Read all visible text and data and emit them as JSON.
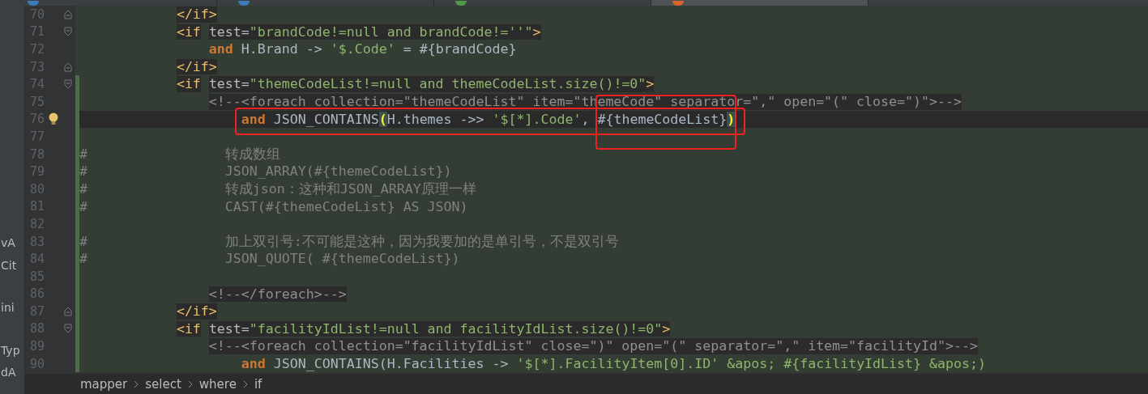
{
  "tabs": [
    {
      "selected": false,
      "color": "#3d7bbf"
    },
    {
      "selected": false,
      "color": "#3d7bbf"
    },
    {
      "selected": false,
      "color": "#4f9a47"
    },
    {
      "selected": true,
      "color": "#d9652b"
    }
  ],
  "project_panel": {
    "fragments": [
      "vA",
      "Cit",
      "ini",
      "Typ",
      "dA"
    ]
  },
  "lines": [
    {
      "number": "70",
      "fold": {
        "kind": "close"
      },
      "changed": false,
      "current": false,
      "tokens": [
        {
          "kind": "tag",
          "text": "            </if>"
        }
      ]
    },
    {
      "number": "71",
      "fold": {
        "kind": "open"
      },
      "changed": false,
      "current": false,
      "tokens": [
        {
          "kind": "tag",
          "text": "            <if"
        },
        {
          "kind": "attr",
          "text": " test="
        },
        {
          "kind": "value",
          "text": "\"brandCode!=null and brandCode!=''\""
        },
        {
          "kind": "tag",
          "text": ">"
        }
      ]
    },
    {
      "number": "72",
      "changed": false,
      "current": false,
      "tokens": [
        {
          "kind": "keyword",
          "text": "                and"
        },
        {
          "kind": "plain",
          "text": " H.Brand -> "
        },
        {
          "kind": "string",
          "text": "'$.Code'"
        },
        {
          "kind": "plain",
          "text": " = #{brandCode}"
        }
      ]
    },
    {
      "number": "73",
      "fold": {
        "kind": "close"
      },
      "changed": false,
      "current": false,
      "tokens": [
        {
          "kind": "tag",
          "text": "            </if>"
        }
      ]
    },
    {
      "number": "74",
      "fold": {
        "kind": "open"
      },
      "changed": true,
      "current": false,
      "tokens": [
        {
          "kind": "tag",
          "text": "            <if"
        },
        {
          "kind": "attr",
          "text": " test="
        },
        {
          "kind": "value",
          "text": "\"themeCodeList!=null and themeCodeList.size()!=0\""
        },
        {
          "kind": "tag",
          "text": ">"
        }
      ]
    },
    {
      "number": "75",
      "changed": true,
      "current": false,
      "tokens": [
        {
          "kind": "xmlcomment",
          "text": "                <!--<foreach collection=\"themeCodeList\" item=\"themeCode\" separator=\",\" open=\"(\" close=\")\">-->"
        }
      ]
    },
    {
      "number": "76",
      "changed": true,
      "current": true,
      "bulb": true,
      "tokens": [
        {
          "kind": "keyword",
          "text": "                    and"
        },
        {
          "kind": "plain",
          "text": " JSON_CONTAINS"
        },
        {
          "kind": "paren",
          "text": "("
        },
        {
          "kind": "plain",
          "text": "H.themes ->> "
        },
        {
          "kind": "string",
          "text": "'$[*].Code'"
        },
        {
          "kind": "plain",
          "text": ", #{themeCodeList}"
        },
        {
          "kind": "paren",
          "text": ")"
        }
      ]
    },
    {
      "number": "77",
      "changed": true,
      "current": false
    },
    {
      "number": "78",
      "changed": true,
      "current": false,
      "tokens": [
        {
          "kind": "comment",
          "text": "#"
        },
        {
          "kind": "comment",
          "text": "                 转成数组"
        }
      ]
    },
    {
      "number": "79",
      "changed": true,
      "current": false,
      "tokens": [
        {
          "kind": "comment",
          "text": "#"
        },
        {
          "kind": "comment",
          "text": "                 JSON_ARRAY(#{themeCodeList})"
        }
      ]
    },
    {
      "number": "80",
      "changed": true,
      "current": false,
      "tokens": [
        {
          "kind": "comment",
          "text": "#"
        },
        {
          "kind": "comment",
          "text": "                 转成json：这种和JSON_ARRAY原理一样"
        }
      ]
    },
    {
      "number": "81",
      "changed": true,
      "current": false,
      "tokens": [
        {
          "kind": "comment",
          "text": "#"
        },
        {
          "kind": "comment",
          "text": "                 CAST(#{themeCodeList} AS JSON)"
        }
      ]
    },
    {
      "number": "82",
      "changed": true,
      "current": false
    },
    {
      "number": "83",
      "changed": true,
      "current": false,
      "tokens": [
        {
          "kind": "comment",
          "text": "#"
        },
        {
          "kind": "comment",
          "text": "                 加上双引号:不可能是这种，因为我要加的是单引号，不是双引号"
        }
      ]
    },
    {
      "number": "84",
      "changed": true,
      "current": false,
      "tokens": [
        {
          "kind": "comment",
          "text": "#"
        },
        {
          "kind": "comment",
          "text": "                 JSON_QUOTE( #{themeCodeList})"
        }
      ]
    },
    {
      "number": "85",
      "changed": true,
      "current": false
    },
    {
      "number": "86",
      "changed": true,
      "current": false,
      "tokens": [
        {
          "kind": "xmlcomment",
          "text": "                <!--</foreach>-->"
        }
      ]
    },
    {
      "number": "87",
      "fold": {
        "kind": "close"
      },
      "changed": true,
      "current": false,
      "tokens": [
        {
          "kind": "tag",
          "text": "            </if>"
        }
      ]
    },
    {
      "number": "88",
      "fold": {
        "kind": "open"
      },
      "changed": true,
      "current": false,
      "tokens": [
        {
          "kind": "tag",
          "text": "            <if"
        },
        {
          "kind": "attr",
          "text": " test="
        },
        {
          "kind": "value",
          "text": "\"facilityIdList!=null and facilityIdList.size()!=0\""
        },
        {
          "kind": "tag",
          "text": ">"
        }
      ]
    },
    {
      "number": "89",
      "changed": true,
      "current": false,
      "tokens": [
        {
          "kind": "xmlcomment",
          "text": "                <!--<foreach collection=\"facilityIdList\" close=\")\" open=\"(\" separator=\",\" item=\"facilityId\">-->"
        }
      ]
    },
    {
      "number": "90",
      "changed": true,
      "current": false,
      "tokens": [
        {
          "kind": "keyword",
          "text": "                    and"
        },
        {
          "kind": "plain",
          "text": " JSON_CONTAINS(H.Facilities -> "
        },
        {
          "kind": "string",
          "text": "'$[*].FacilityItem[0].ID'"
        },
        {
          "kind": "string",
          "text": " &apos; #{facilityIdList} &apos;)"
        }
      ]
    }
  ],
  "breadcrumbs": [
    "mapper",
    "select",
    "where",
    "if"
  ]
}
